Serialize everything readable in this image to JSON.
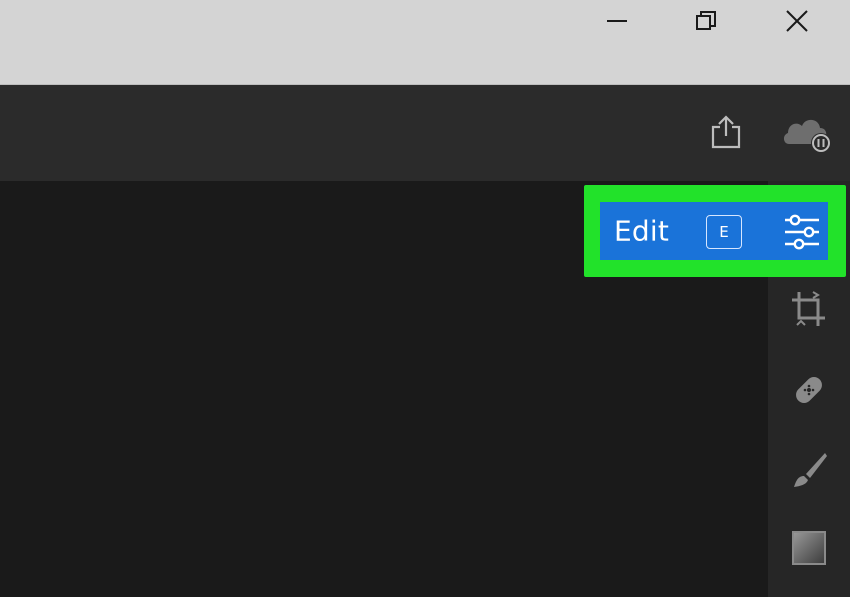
{
  "window_controls": {
    "minimize_icon": "minimize-icon",
    "restore_icon": "restore-icon",
    "close_icon": "close-icon"
  },
  "toolbar": {
    "share_icon": "share-icon",
    "cloud_sync_icon": "cloud-sync-paused-icon"
  },
  "edit_button": {
    "label": "Edit",
    "shortcut": "E",
    "icon": "sliders-icon"
  },
  "tool_rail": {
    "tools": [
      {
        "icon": "crop-icon"
      },
      {
        "icon": "healing-bandage-icon"
      },
      {
        "icon": "brush-icon"
      },
      {
        "icon": "gradient-icon"
      }
    ]
  },
  "colors": {
    "titlebar": "#d4d4d4",
    "toolbar": "#2b2b2b",
    "canvas": "#1a1a1a",
    "rail": "#262626",
    "accent_blue": "#1a73d9",
    "highlight_green": "#22e22a"
  }
}
